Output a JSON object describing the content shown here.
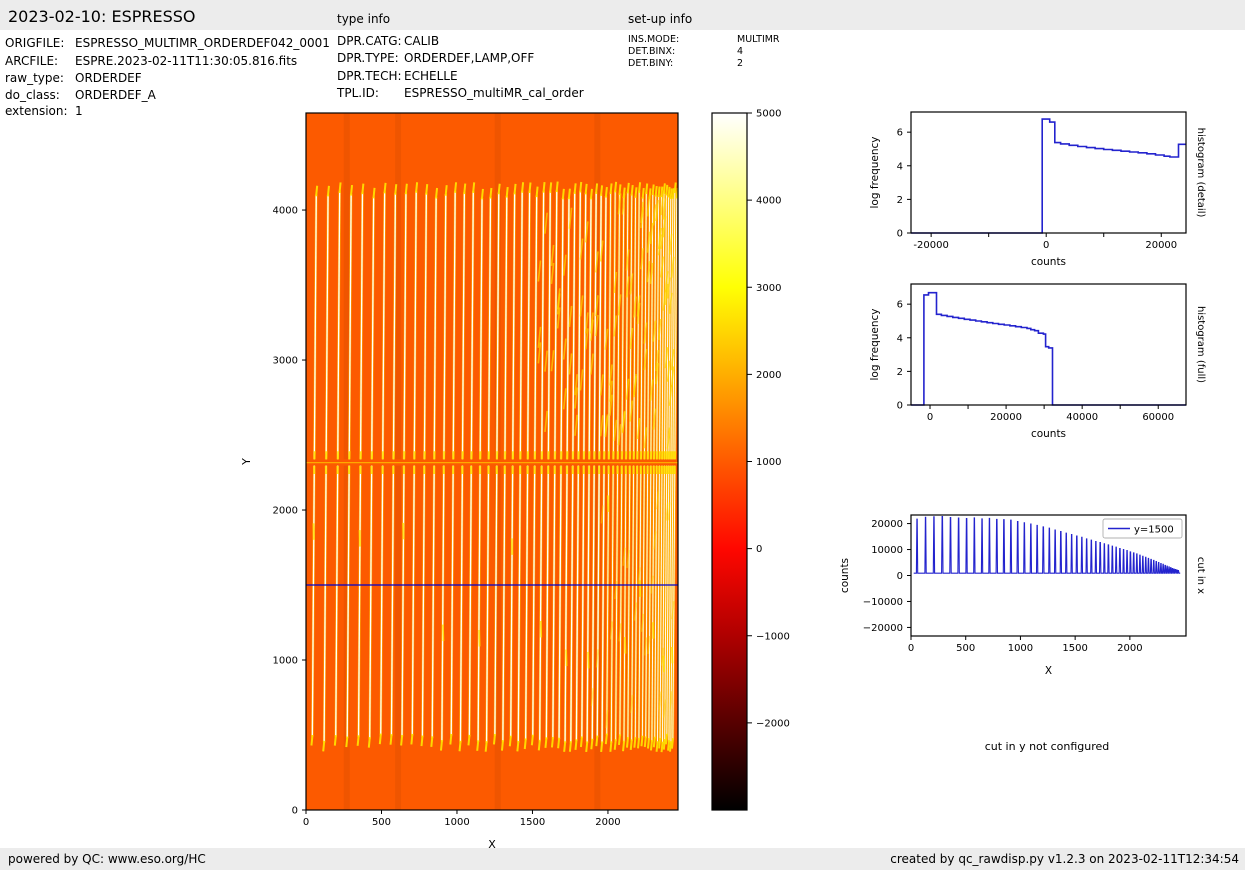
{
  "header": {
    "title": "2023-02-10: ESPRESSO",
    "type_info_label": "type info",
    "setup_info_label": "set-up info"
  },
  "meta_left": [
    {
      "label": "ORIGFILE:",
      "value": "ESPRESSO_MULTIMR_ORDERDEF042_0001"
    },
    {
      "label": "ARCFILE:",
      "value": "ESPRE.2023-02-11T11:30:05.816.fits"
    },
    {
      "label": "raw_type:",
      "value": "ORDERDEF"
    },
    {
      "label": "do_class:",
      "value": "ORDERDEF_A"
    },
    {
      "label": "extension:",
      "value": "1"
    }
  ],
  "type_info": [
    {
      "label": "DPR.CATG:",
      "value": "CALIB"
    },
    {
      "label": "DPR.TYPE:",
      "value": "ORDERDEF,LAMP,OFF"
    },
    {
      "label": "DPR.TECH:",
      "value": "ECHELLE"
    },
    {
      "label": "TPL.ID:",
      "value": "ESPRESSO_multiMR_cal_order"
    }
  ],
  "setup_info": [
    {
      "label": "INS.MODE:",
      "value": "MULTIMR"
    },
    {
      "label": "DET.BINX:",
      "value": "4"
    },
    {
      "label": "DET.BINY:",
      "value": "2"
    }
  ],
  "footer": {
    "left": "powered by QC: www.eso.org/HC",
    "right": "created by qc_rawdisp.py v1.2.3 on 2023-02-11T12:34:54"
  },
  "cut_y_note": "cut in y not configured",
  "chart_data": [
    {
      "type": "heatmap",
      "name": "raw-image",
      "xlabel": "X",
      "ylabel": "Y",
      "xlim": [
        0,
        2464
      ],
      "ylim": [
        0,
        4647
      ],
      "xticks": [
        0,
        500,
        1000,
        1500,
        2000
      ],
      "yticks": [
        0,
        1000,
        2000,
        3000,
        4000
      ],
      "background_color": "#FC5A00",
      "background_value": 1000,
      "orders_y_bottom": 455,
      "orders_y_top": 4095,
      "chip_gap_y": 2316,
      "cut_line": {
        "y": 1500,
        "color": "#0000CC"
      },
      "stripe_core_color": "#FFFFFF",
      "stripe_halo_color": "#FFC400",
      "tip_color": "#FFE000",
      "stripes": [
        [
          55,
          21700
        ],
        [
          133,
          22400
        ],
        [
          210,
          22600
        ],
        [
          286,
          22700
        ],
        [
          361,
          22300
        ],
        [
          435,
          22100
        ],
        [
          508,
          21900
        ],
        [
          579,
          22200
        ],
        [
          649,
          21800
        ],
        [
          717,
          22000
        ],
        [
          784,
          21600
        ],
        [
          849,
          21500
        ],
        [
          913,
          21300
        ],
        [
          975,
          20800
        ],
        [
          1036,
          20300
        ],
        [
          1095,
          19800
        ],
        [
          1153,
          19300
        ],
        [
          1209,
          18700
        ],
        [
          1264,
          18200
        ],
        [
          1317,
          17500
        ],
        [
          1369,
          16900
        ],
        [
          1419,
          16300
        ],
        [
          1468,
          15800
        ],
        [
          1515,
          15200
        ],
        [
          1561,
          14700
        ],
        [
          1605,
          14100
        ],
        [
          1648,
          13600
        ],
        [
          1689,
          13100
        ],
        [
          1729,
          12700
        ],
        [
          1767,
          12200
        ],
        [
          1804,
          11800
        ],
        [
          1840,
          11300
        ],
        [
          1875,
          10900
        ],
        [
          1909,
          10400
        ],
        [
          1942,
          10000
        ],
        [
          1974,
          9600
        ],
        [
          2005,
          9100
        ],
        [
          2035,
          8700
        ],
        [
          2064,
          8300
        ],
        [
          2092,
          7800
        ],
        [
          2119,
          7400
        ],
        [
          2145,
          7000
        ],
        [
          2170,
          6600
        ],
        [
          2194,
          6200
        ],
        [
          2218,
          5800
        ],
        [
          2241,
          5400
        ],
        [
          2263,
          5000
        ],
        [
          2284,
          4600
        ],
        [
          2304,
          4300
        ],
        [
          2323,
          3900
        ],
        [
          2341,
          3600
        ],
        [
          2358,
          3300
        ],
        [
          2374,
          3000
        ],
        [
          2389,
          2700
        ],
        [
          2403,
          2500
        ],
        [
          2417,
          2300
        ],
        [
          2430,
          2100
        ],
        [
          2443,
          1900
        ]
      ]
    },
    {
      "type": "colorbar",
      "name": "colorbar",
      "vmin": -3000,
      "vmax": 5000,
      "ticks": [
        5000,
        4000,
        3000,
        2000,
        1000,
        0,
        -1000,
        -2000
      ],
      "colormap": "hot",
      "stops": [
        [
          0,
          "#FFFFFF"
        ],
        [
          0.125,
          "#FFFF82"
        ],
        [
          0.25,
          "#FFFF04"
        ],
        [
          0.375,
          "#FFAE00"
        ],
        [
          0.5,
          "#FF5A00"
        ],
        [
          0.625,
          "#FF0700"
        ],
        [
          0.75,
          "#AF0000"
        ],
        [
          0.875,
          "#570000"
        ],
        [
          1,
          "#000000"
        ]
      ]
    },
    {
      "type": "line",
      "name": "histogram-detail",
      "xlabel": "counts",
      "ylabel": "log frequency",
      "right_label": "histogram (detail)",
      "xlim": [
        -23500,
        24300
      ],
      "ylim": [
        0,
        7.2
      ],
      "xticks_major": [
        -20000,
        0,
        20000
      ],
      "xticks_minor": [
        -10000,
        10000
      ],
      "yticks": [
        0,
        2,
        4,
        6
      ],
      "color": "#2323CE",
      "points": [
        [
          -23500,
          0
        ],
        [
          -700,
          0
        ],
        [
          -700,
          6.78
        ],
        [
          600,
          6.78
        ],
        [
          600,
          6.6
        ],
        [
          1500,
          6.6
        ],
        [
          1500,
          5.38
        ],
        [
          2500,
          5.38
        ],
        [
          2500,
          5.3
        ],
        [
          4000,
          5.3
        ],
        [
          4000,
          5.22
        ],
        [
          5500,
          5.22
        ],
        [
          5500,
          5.15
        ],
        [
          7000,
          5.15
        ],
        [
          7000,
          5.08
        ],
        [
          8500,
          5.08
        ],
        [
          8500,
          5.02
        ],
        [
          10000,
          5.02
        ],
        [
          10000,
          4.97
        ],
        [
          11500,
          4.97
        ],
        [
          11500,
          4.92
        ],
        [
          13000,
          4.92
        ],
        [
          13000,
          4.87
        ],
        [
          14500,
          4.87
        ],
        [
          14500,
          4.82
        ],
        [
          16000,
          4.82
        ],
        [
          16000,
          4.77
        ],
        [
          17500,
          4.77
        ],
        [
          17500,
          4.71
        ],
        [
          19000,
          4.71
        ],
        [
          19000,
          4.64
        ],
        [
          20500,
          4.64
        ],
        [
          20500,
          4.57
        ],
        [
          21500,
          4.57
        ],
        [
          21500,
          4.52
        ],
        [
          23000,
          4.52
        ],
        [
          23000,
          5.28
        ],
        [
          24300,
          5.28
        ]
      ]
    },
    {
      "type": "line",
      "name": "histogram-full",
      "xlabel": "counts",
      "ylabel": "log frequency",
      "right_label": "histogram (full)",
      "xlim": [
        -5000,
        67300
      ],
      "ylim": [
        0,
        7.2
      ],
      "xticks_major": [
        0,
        20000,
        40000,
        60000
      ],
      "xticks_minor": [
        10000,
        30000,
        50000
      ],
      "yticks": [
        0,
        2,
        4,
        6
      ],
      "color": "#2323CE",
      "points": [
        [
          -5000,
          0
        ],
        [
          -1600,
          0
        ],
        [
          -1600,
          6.55
        ],
        [
          -400,
          6.55
        ],
        [
          -400,
          6.68
        ],
        [
          1700,
          6.68
        ],
        [
          1700,
          5.4
        ],
        [
          3000,
          5.4
        ],
        [
          3000,
          5.33
        ],
        [
          4500,
          5.33
        ],
        [
          4500,
          5.27
        ],
        [
          6000,
          5.27
        ],
        [
          6000,
          5.21
        ],
        [
          7500,
          5.21
        ],
        [
          7500,
          5.16
        ],
        [
          9000,
          5.16
        ],
        [
          9000,
          5.1
        ],
        [
          10500,
          5.1
        ],
        [
          10500,
          5.05
        ],
        [
          12000,
          5.05
        ],
        [
          12000,
          5.0
        ],
        [
          13500,
          5.0
        ],
        [
          13500,
          4.95
        ],
        [
          15000,
          4.95
        ],
        [
          15000,
          4.9
        ],
        [
          16500,
          4.9
        ],
        [
          16500,
          4.85
        ],
        [
          18000,
          4.85
        ],
        [
          18000,
          4.8
        ],
        [
          19500,
          4.8
        ],
        [
          19500,
          4.76
        ],
        [
          21000,
          4.76
        ],
        [
          21000,
          4.71
        ],
        [
          22500,
          4.71
        ],
        [
          22500,
          4.66
        ],
        [
          24000,
          4.66
        ],
        [
          24000,
          4.61
        ],
        [
          25500,
          4.61
        ],
        [
          25500,
          4.56
        ],
        [
          26500,
          4.56
        ],
        [
          26500,
          4.48
        ],
        [
          27500,
          4.48
        ],
        [
          27500,
          4.42
        ],
        [
          28500,
          4.42
        ],
        [
          28500,
          4.27
        ],
        [
          29800,
          4.27
        ],
        [
          29800,
          4.22
        ],
        [
          30400,
          4.22
        ],
        [
          30400,
          3.47
        ],
        [
          31200,
          3.47
        ],
        [
          31200,
          3.4
        ],
        [
          32200,
          3.4
        ],
        [
          32200,
          0
        ],
        [
          67300,
          0
        ]
      ]
    },
    {
      "type": "line",
      "name": "cut-in-x",
      "xlabel": "X",
      "ylabel": "counts",
      "right_label": "cut in x",
      "legend": [
        {
          "label": "y=1500",
          "color": "#2323CE"
        }
      ],
      "xlim": [
        0,
        2513
      ],
      "ylim": [
        -23300,
        23300
      ],
      "xticks": [
        0,
        500,
        1000,
        1500,
        2000
      ],
      "yticks": [
        -20000,
        -10000,
        0,
        10000,
        20000
      ],
      "baseline": 900,
      "spikes_ref": "chart_data.0.stripes"
    }
  ]
}
